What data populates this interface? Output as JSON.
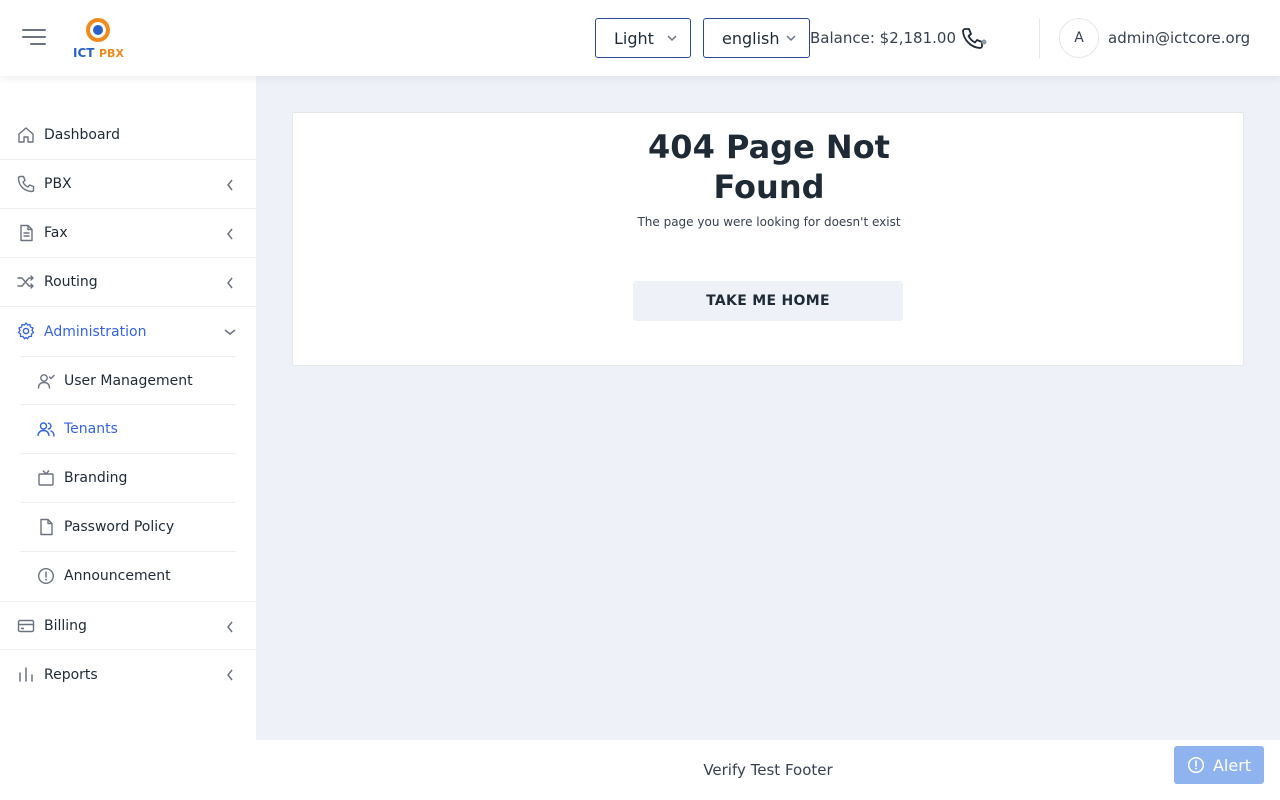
{
  "header": {
    "logo_text": "ICTPBX",
    "theme_select": {
      "value": "Light"
    },
    "language_select": {
      "value": "english"
    },
    "balance": "Balance: $2,181.00",
    "avatar_initial": "A",
    "user_email": "admin@ictcore.org"
  },
  "sidebar": {
    "items": [
      {
        "label": "Dashboard",
        "icon": "home-icon"
      },
      {
        "label": "PBX",
        "icon": "phone-icon"
      },
      {
        "label": "Fax",
        "icon": "document-icon"
      },
      {
        "label": "Routing",
        "icon": "shuffle-icon"
      },
      {
        "label": "Administration",
        "icon": "gear-icon",
        "expanded": true
      },
      {
        "label": "Billing",
        "icon": "credit-card-icon"
      },
      {
        "label": "Reports",
        "icon": "bar-chart-icon"
      }
    ],
    "administration_subitems": [
      {
        "label": "User Management",
        "icon": "user-check-icon"
      },
      {
        "label": "Tenants",
        "icon": "users-icon",
        "active": true
      },
      {
        "label": "Branding",
        "icon": "tv-icon"
      },
      {
        "label": "Password Policy",
        "icon": "file-icon"
      },
      {
        "label": "Announcement",
        "icon": "alert-circle-icon"
      }
    ]
  },
  "main": {
    "title_line1": "404 Page Not",
    "title_line2": "Found",
    "subtitle": "The page you were looking for doesn't exist",
    "home_button": "TAKE ME HOME"
  },
  "footer": {
    "text": "Verify Test Footer"
  },
  "alert_button": "Alert",
  "colors": {
    "accent": "#3563e9",
    "background": "#eef1f8",
    "alert": "#8fb3ee",
    "select_border": "#2b4a8f"
  }
}
